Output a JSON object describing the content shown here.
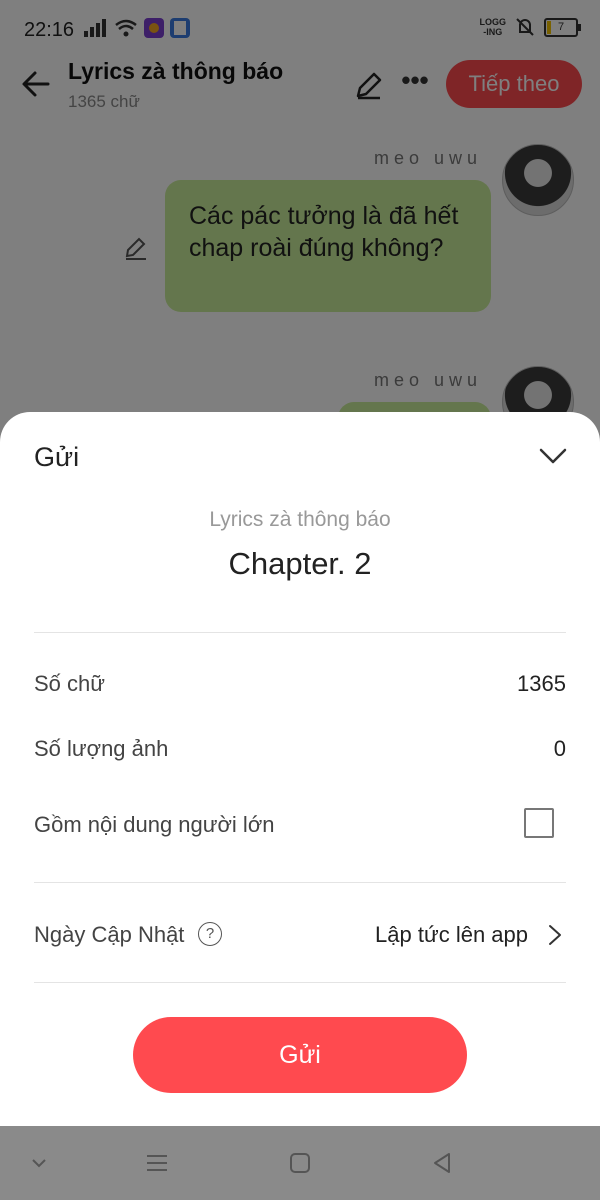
{
  "status_bar": {
    "time": "22:16",
    "logging_label": "LOGG\n-ING",
    "battery": "7"
  },
  "header": {
    "title": "Lyrics zà thông báo",
    "subtitle": "1365 chữ",
    "next_label": "Tiếp theo"
  },
  "chat": {
    "messages": [
      {
        "author": "meo uwu",
        "text": "Các pác tưởng là đã hết chap roài đúng không?"
      },
      {
        "author": "meo uwu",
        "text": ""
      }
    ]
  },
  "sheet": {
    "title": "Gửi",
    "story_name": "Lyrics zà thông báo",
    "chapter_name": "Chapter. 2",
    "rows": {
      "word_count_label": "Số chữ",
      "word_count_value": "1365",
      "image_count_label": "Số lượng ảnh",
      "image_count_value": "0",
      "adult_label": "Gồm nội dung người lớn",
      "update_label": "Ngày Cập Nhật",
      "update_value": "Lập tức lên app"
    },
    "adult_checked": false,
    "send_label": "Gửi"
  },
  "colors": {
    "accent": "#ff4a4f",
    "bubble": "#c9ec9a"
  }
}
